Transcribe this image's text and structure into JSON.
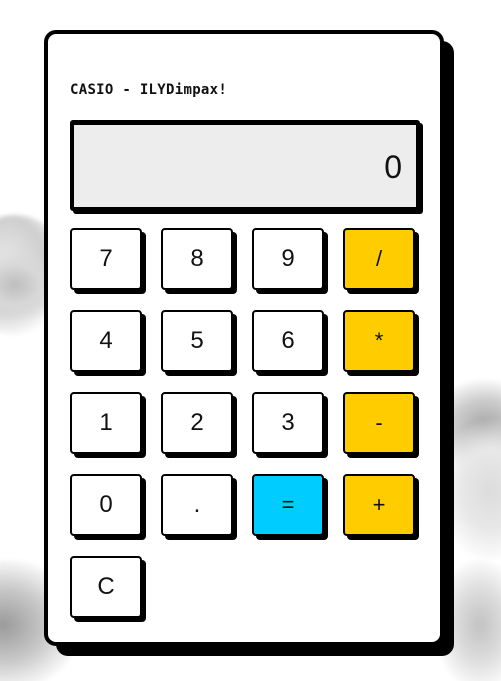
{
  "brand_label": "CASIO - ILYDimpax!",
  "display": {
    "value": "0"
  },
  "keys": [
    {
      "label": "7",
      "kind": "digit"
    },
    {
      "label": "8",
      "kind": "digit"
    },
    {
      "label": "9",
      "kind": "digit"
    },
    {
      "label": "/",
      "kind": "operator"
    },
    {
      "label": "4",
      "kind": "digit"
    },
    {
      "label": "5",
      "kind": "digit"
    },
    {
      "label": "6",
      "kind": "digit"
    },
    {
      "label": "*",
      "kind": "operator"
    },
    {
      "label": "1",
      "kind": "digit"
    },
    {
      "label": "2",
      "kind": "digit"
    },
    {
      "label": "3",
      "kind": "digit"
    },
    {
      "label": "-",
      "kind": "operator"
    },
    {
      "label": "0",
      "kind": "digit"
    },
    {
      "label": ".",
      "kind": "decimal"
    },
    {
      "label": "=",
      "kind": "equals"
    },
    {
      "label": "+",
      "kind": "operator"
    },
    {
      "label": "C",
      "kind": "clear"
    }
  ],
  "colors": {
    "operator_key": "#ffcc00",
    "equals_key": "#00ccff",
    "display_bg": "#ededed",
    "key_bg": "#ffffff",
    "border": "#000000"
  }
}
